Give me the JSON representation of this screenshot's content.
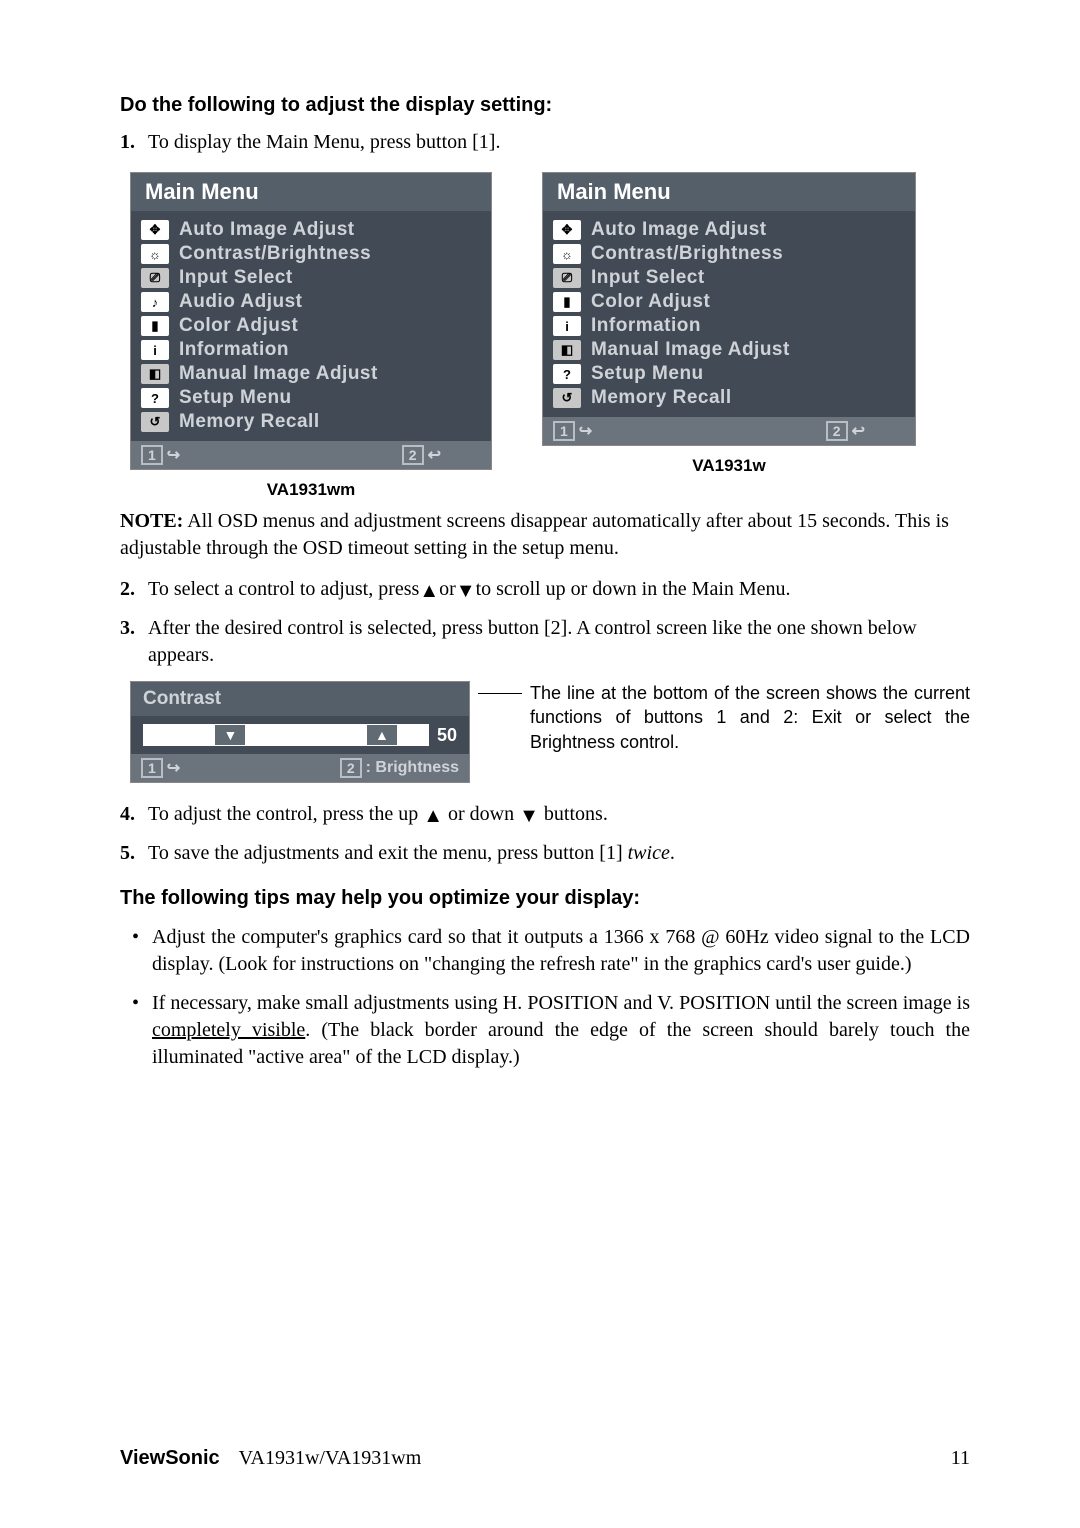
{
  "heading": "Do the following to adjust the display setting:",
  "steps": {
    "s1_num": "1.",
    "s1_text": "To display the Main Menu, press button [1].",
    "s2_num": "2.",
    "s2_text_a": "To select a control to adjust, press",
    "s2_text_b": "or",
    "s2_text_c": "to scroll up or down in the Main Menu.",
    "s3_num": "3.",
    "s3_text": "After the desired control is selected, press button [2]. A control screen like the one shown below appears.",
    "s4_num": "4.",
    "s4_text_a": "To adjust the control, press the up ",
    "s4_text_b": " or down ",
    "s4_text_c": " buttons.",
    "s5_num": "5.",
    "s5_text_a": "To save the adjustments and exit the menu, press button [1] ",
    "s5_text_b": "twice",
    "s5_text_c": "."
  },
  "note": {
    "label": "NOTE:",
    "text": " All OSD menus and adjustment screens disappear automatically after about 15 seconds. This is adjustable through the OSD timeout setting in the setup menu."
  },
  "panels": {
    "title": "Main Menu",
    "caption_left": "VA1931wm",
    "caption_right": "VA1931w",
    "foot_key1": "1",
    "foot_key2": "2",
    "left_items": [
      {
        "icon": "move-icon",
        "glyph": "✥",
        "label": "Auto Image Adjust"
      },
      {
        "icon": "brightness-icon",
        "glyph": "☼",
        "label": "Contrast/Brightness"
      },
      {
        "icon": "input-icon",
        "glyph": "⎚",
        "label": "Input Select"
      },
      {
        "icon": "audio-icon",
        "glyph": "♪",
        "label": "Audio Adjust"
      },
      {
        "icon": "color-icon",
        "glyph": "▮",
        "label": "Color Adjust"
      },
      {
        "icon": "info-icon",
        "glyph": "i",
        "label": "Information"
      },
      {
        "icon": "manual-icon",
        "glyph": "◧",
        "label": "Manual Image Adjust"
      },
      {
        "icon": "setup-icon",
        "glyph": "?",
        "label": "Setup Menu"
      },
      {
        "icon": "recall-icon",
        "glyph": "↺",
        "label": "Memory Recall"
      }
    ],
    "right_items": [
      {
        "icon": "move-icon",
        "glyph": "✥",
        "label": "Auto Image Adjust"
      },
      {
        "icon": "brightness-icon",
        "glyph": "☼",
        "label": "Contrast/Brightness"
      },
      {
        "icon": "input-icon",
        "glyph": "⎚",
        "label": "Input Select"
      },
      {
        "icon": "color-icon",
        "glyph": "▮",
        "label": "Color Adjust"
      },
      {
        "icon": "info-icon",
        "glyph": "i",
        "label": "Information"
      },
      {
        "icon": "manual-icon",
        "glyph": "◧",
        "label": "Manual Image Adjust"
      },
      {
        "icon": "setup-icon",
        "glyph": "?",
        "label": "Setup Menu"
      },
      {
        "icon": "recall-icon",
        "glyph": "↺",
        "label": "Memory Recall"
      }
    ]
  },
  "contrast": {
    "title": "Contrast",
    "value": "50",
    "foot1": "1",
    "foot2_label": ": Brightness",
    "foot2": "2",
    "explain": "The line at the bottom of the screen shows the current functions of buttons 1 and 2: Exit or select the Brightness control."
  },
  "tips": {
    "heading": "The following tips may help you optimize your display:",
    "b1": "Adjust the computer's graphics card so that it outputs a 1366 x 768 @ 60Hz video signal to the LCD display. (Look for instructions on \"changing the refresh rate\" in the graphics card's user guide.)",
    "b2_a": "If necessary, make small adjustments using H. POSITION and V. POSITION until the screen image is ",
    "b2_u": "completely visible",
    "b2_b": ". (The black border around the edge of the screen should barely touch the illuminated \"active area\" of the LCD display.)"
  },
  "footer": {
    "brand": "ViewSonic",
    "model": "VA1931w/VA1931wm",
    "page": "11"
  },
  "glyphs": {
    "exit_arrow": "↪",
    "enter_arrow": "↩",
    "tri_up": "▲",
    "tri_down": "▼"
  }
}
